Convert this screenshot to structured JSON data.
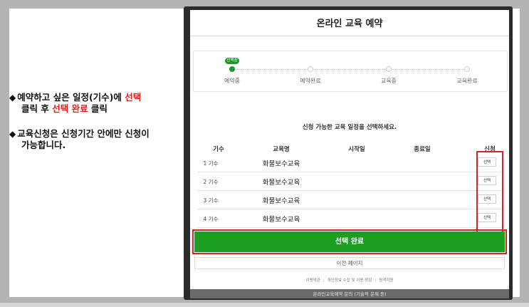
{
  "instructions": {
    "bullet1": {
      "marker": "◆",
      "part_a": "예약하고 싶은 일정(기수)에 ",
      "part_b_red": "선택",
      "line2_a": "클릭 후 ",
      "line2_b_red": "선택 완료",
      "line2_c": " 클릭"
    },
    "bullet2": {
      "marker": "◆",
      "line1": "교육신청은 신청기간 안에만 신청이",
      "line2": "가능합니다."
    }
  },
  "screen": {
    "title": "온라인 교육 예약",
    "stepper": {
      "active_badge": "선택중",
      "steps": [
        "예약중",
        "예약완료",
        "교육중",
        "교육완료"
      ],
      "active_index": 0
    },
    "instruction": "신청 가능한 교육 일정을 선택하세요.",
    "table": {
      "headers": [
        "기수",
        "교육명",
        "시작일",
        "종료일",
        "신청"
      ],
      "rows": [
        {
          "round": "1 기수",
          "course": "화물보수교육",
          "start": "",
          "end": "",
          "action": "선택"
        },
        {
          "round": "2 기수",
          "course": "화물보수교육",
          "start": "",
          "end": "",
          "action": "선택"
        },
        {
          "round": "3 기수",
          "course": "화물보수교육",
          "start": "",
          "end": "",
          "action": "선택"
        },
        {
          "round": "4 기수",
          "course": "화물보수교육",
          "start": "",
          "end": "",
          "action": "선택"
        }
      ]
    },
    "complete_button": "선택 완료",
    "prev_button": "이전 페이지",
    "footer_links": [
      "이용약관",
      "개인정보 수집 및 이용 방침",
      "원격지원"
    ],
    "footer_bar": "온라인교육예약 문의 (기술적 문제 등)"
  },
  "colors": {
    "accent_green": "#1c9f21",
    "highlight_red": "#d8232a",
    "instruction_red": "#e0211b"
  }
}
